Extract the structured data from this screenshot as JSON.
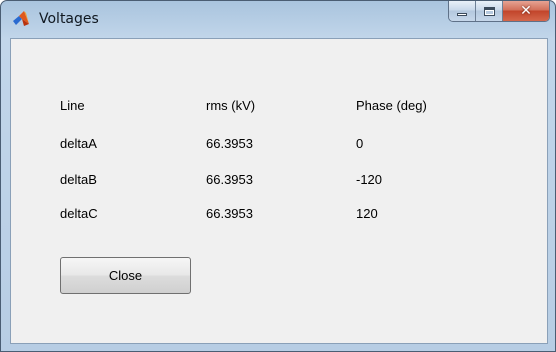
{
  "window": {
    "title": "Voltages",
    "app_icon": "matlab-icon",
    "caption_buttons": [
      "minimize",
      "maximize",
      "close"
    ]
  },
  "table": {
    "headers": {
      "line": "Line",
      "rms": "rms (kV)",
      "phase": "Phase (deg)"
    },
    "rows": [
      {
        "line": "deltaA",
        "rms": "66.3953",
        "phase": "0"
      },
      {
        "line": "deltaB",
        "rms": "66.3953",
        "phase": "-120"
      },
      {
        "line": "deltaC",
        "rms": "66.3953",
        "phase": "120"
      }
    ]
  },
  "actions": {
    "close_label": "Close"
  },
  "colors": {
    "titlebar": "#b7cde4",
    "client_bg": "#f0f0f0",
    "close_caption": "#c2452b"
  }
}
